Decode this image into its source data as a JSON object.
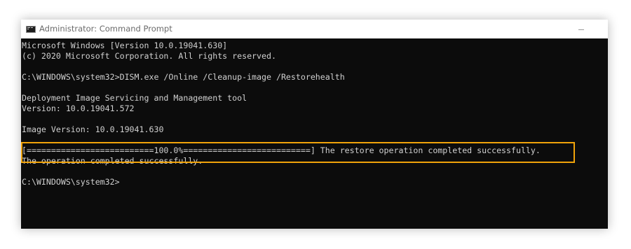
{
  "window": {
    "title": "Administrator: Command Prompt",
    "minimize_glyph": "minimize"
  },
  "console": {
    "lines": [
      "Microsoft Windows [Version 10.0.19041.630]",
      "(c) 2020 Microsoft Corporation. All rights reserved.",
      "",
      "C:\\WINDOWS\\system32>DISM.exe /Online /Cleanup-image /Restorehealth",
      "",
      "Deployment Image Servicing and Management tool",
      "Version: 10.0.19041.572",
      "",
      "Image Version: 10.0.19041.630",
      "",
      "[==========================100.0%==========================] The restore operation completed successfully.",
      "The operation completed successfully.",
      "",
      "C:\\WINDOWS\\system32>"
    ]
  },
  "colors": {
    "console_background": "#0c0c0c",
    "console_text": "#d0d0d0",
    "highlight_border": "#f0a30a",
    "titlebar_background": "#ffffff"
  },
  "icons": {
    "app_icon": "cmd-icon"
  }
}
